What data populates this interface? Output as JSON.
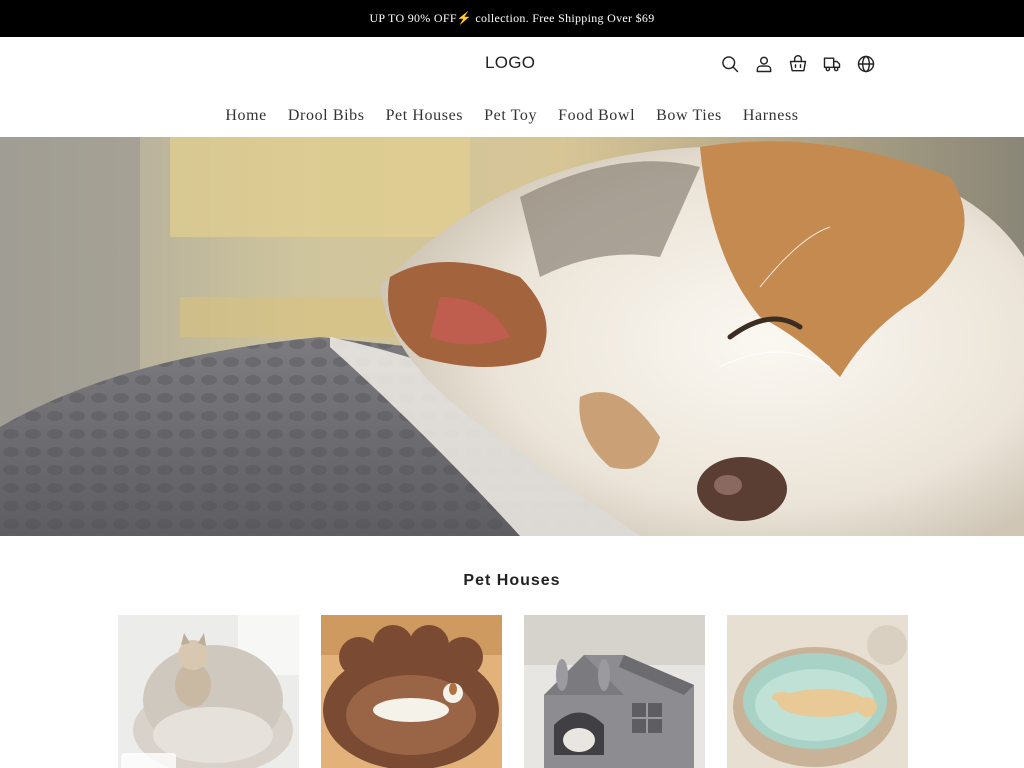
{
  "announcement": {
    "text": "UP TO 90% OFF⚡ collection. Free Shipping Over $69"
  },
  "header": {
    "logo": "LOGO",
    "icons": [
      "search-icon",
      "account-icon",
      "cart-icon",
      "shipping-truck-icon",
      "globe-icon"
    ]
  },
  "nav": {
    "items": [
      "Home",
      "Drool Bibs",
      "Pet Houses",
      "Pet Toy",
      "Food Bowl",
      "Bow Ties",
      "Harness"
    ]
  },
  "section": {
    "title": "Pet Houses"
  },
  "colors": {
    "announce_bg": "#000000",
    "text": "#222222",
    "background": "#ffffff"
  }
}
